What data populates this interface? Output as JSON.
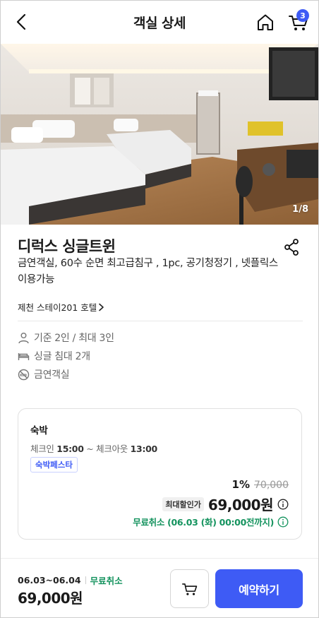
{
  "header": {
    "title": "객실 상세",
    "back_icon": "chevron-left-icon",
    "home_icon": "home-icon",
    "cart_icon": "cart-icon",
    "cart_count": "3"
  },
  "photo": {
    "counter": "1/8"
  },
  "room": {
    "name": "디럭스 싱글트윈",
    "description": "금연객실, 60수 순면 최고급침구 , 1pc, 공기청정기 , 넷플릭스 이용가능",
    "hotel_link": "제천 스테이201 호텔",
    "share_icon": "share-icon"
  },
  "features": [
    {
      "icon": "person-icon",
      "label": "기준 2인 / 최대 3인"
    },
    {
      "icon": "bed-icon",
      "label": "싱글 침대 2개"
    },
    {
      "icon": "no-smoking-icon",
      "label": "금연객실"
    }
  ],
  "rate": {
    "title": "숙박",
    "checkin_label": "체크인",
    "checkin_time": "15:00",
    "tilde": "~",
    "checkout_label": "체크아웃",
    "checkout_time": "13:00",
    "promo": "숙박페스타",
    "discount": "1%",
    "original_price": "70,000",
    "max_discount_label": "최대할인가",
    "final_price": "69,000원",
    "free_cancel": "무료취소 (06.03 (화) 00:00전까지)"
  },
  "bottom": {
    "dates": "06.03~06.04",
    "free_cancel": "무료취소",
    "price": "69,000원",
    "book_label": "예약하기"
  },
  "colors": {
    "accent": "#3e5bf5",
    "green": "#14935e"
  }
}
